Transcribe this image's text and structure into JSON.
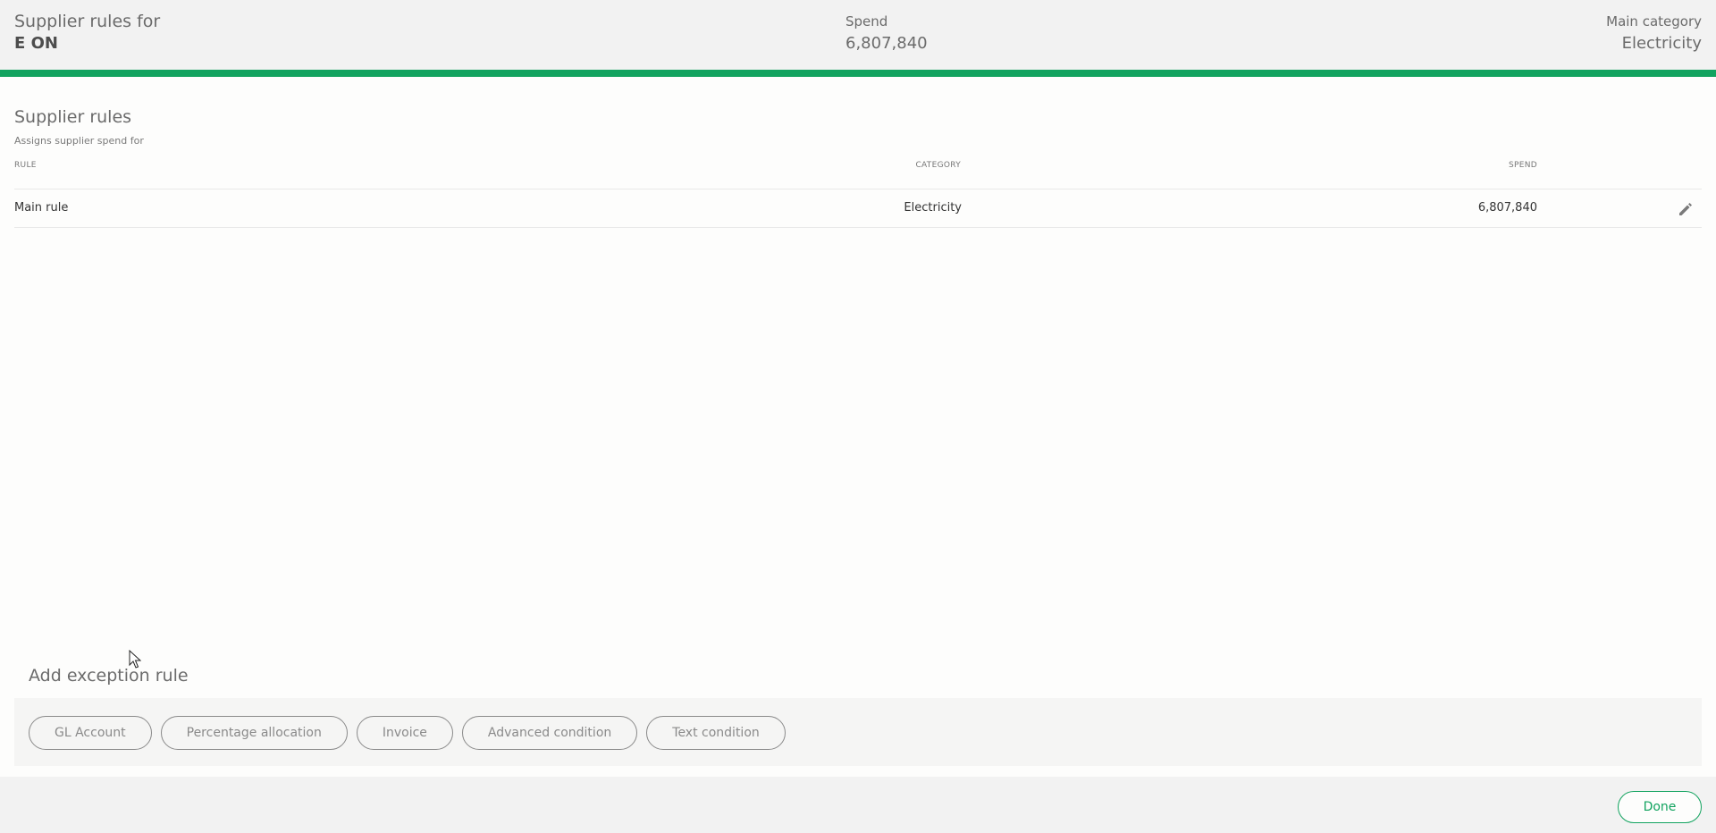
{
  "header": {
    "title_label": "Supplier rules for",
    "supplier_name": "E ON",
    "spend_label": "Spend",
    "spend_value": "6,807,840",
    "category_label": "Main category",
    "category_value": "Electricity"
  },
  "colors": {
    "accent": "#12a35f",
    "header_bg": "#f2f2f2"
  },
  "supplier_rules": {
    "title": "Supplier rules",
    "subtitle": "Assigns supplier spend for",
    "columns": {
      "rule": "RULE",
      "category": "CATEGORY",
      "spend": "SPEND"
    },
    "rows": [
      {
        "rule": "Main rule",
        "category": "Electricity",
        "spend": "6,807,840",
        "action_icon": "pencil-icon"
      }
    ]
  },
  "exception": {
    "title": "Add exception rule",
    "options": [
      "GL Account",
      "Percentage allocation",
      "Invoice",
      "Advanced condition",
      "Text condition"
    ]
  },
  "footer": {
    "done_label": "Done"
  }
}
